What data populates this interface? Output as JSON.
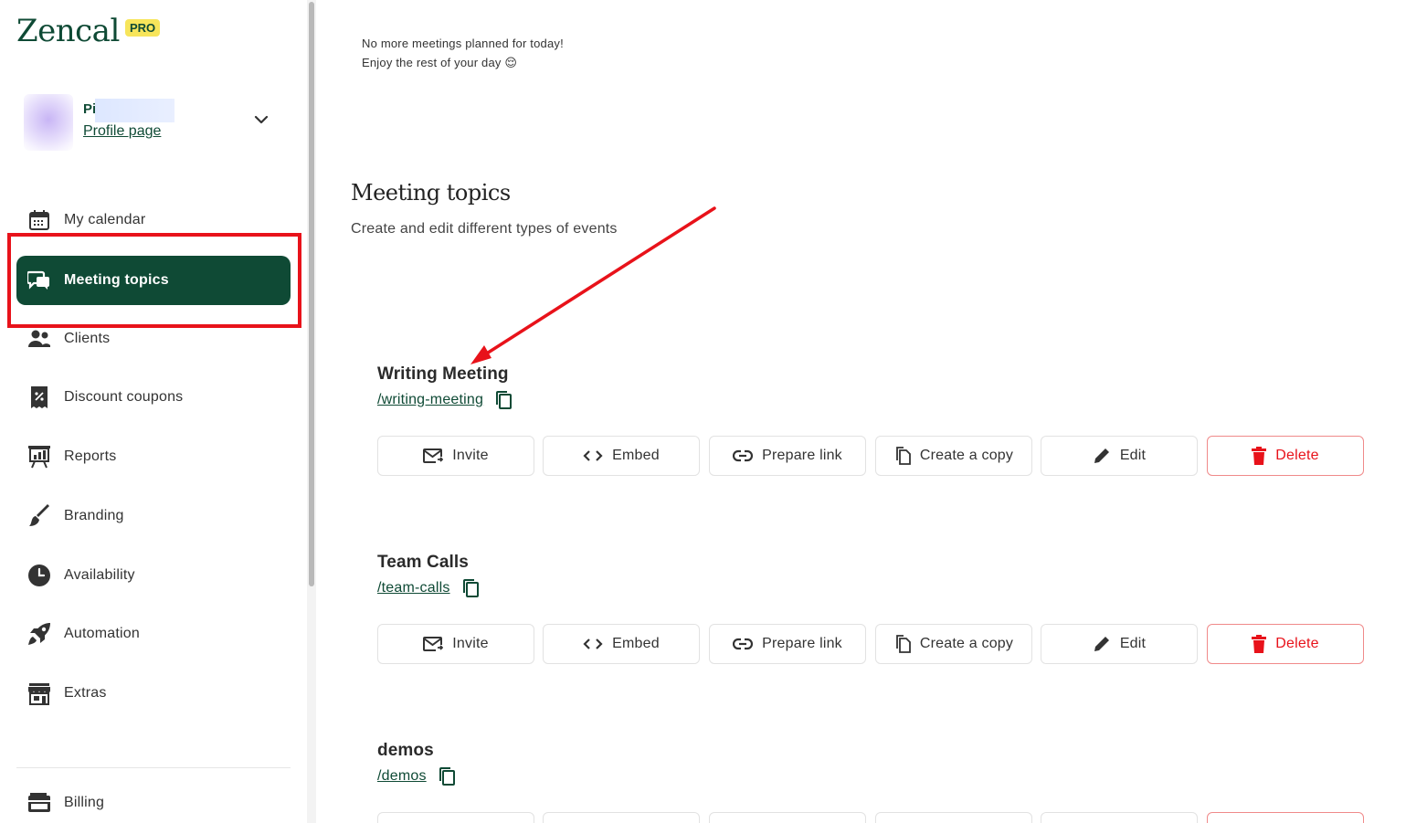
{
  "brand": {
    "logo_text": "Zencal",
    "badge": "PRO"
  },
  "profile": {
    "name_visible": "Pi",
    "link_label": "Profile page"
  },
  "sidebar": {
    "items": [
      {
        "label": "My calendar",
        "icon": "calendar-icon"
      },
      {
        "label": "Meeting topics",
        "icon": "chat-bubbles-icon",
        "active": true
      },
      {
        "label": "Clients",
        "icon": "users-icon"
      },
      {
        "label": "Discount coupons",
        "icon": "coupon-icon"
      },
      {
        "label": "Reports",
        "icon": "chart-board-icon"
      },
      {
        "label": "Branding",
        "icon": "paintbrush-icon"
      },
      {
        "label": "Availability",
        "icon": "clock-icon"
      },
      {
        "label": "Automation",
        "icon": "rocket-icon"
      },
      {
        "label": "Extras",
        "icon": "store-icon"
      }
    ],
    "billing": {
      "label": "Billing",
      "icon": "wallet-icon"
    }
  },
  "main": {
    "note_line1": "No more meetings planned for today!",
    "note_line2": "Enjoy the rest of your day 😌",
    "title": "Meeting topics",
    "subtitle": "Create and edit different types of events",
    "topics": [
      {
        "title": "Writing Meeting",
        "slug": "/writing-meeting"
      },
      {
        "title": "Team Calls",
        "slug": "/team-calls"
      },
      {
        "title": "demos",
        "slug": "/demos"
      }
    ],
    "actions": {
      "invite": "Invite",
      "embed": "Embed",
      "prepare_link": "Prepare link",
      "create_copy": "Create a copy",
      "edit": "Edit",
      "delete": "Delete"
    }
  },
  "colors": {
    "brand_green": "#0f4a35",
    "badge_yellow": "#f7e55b",
    "delete_red": "#e8121a",
    "annotation_red": "#e8121a"
  }
}
